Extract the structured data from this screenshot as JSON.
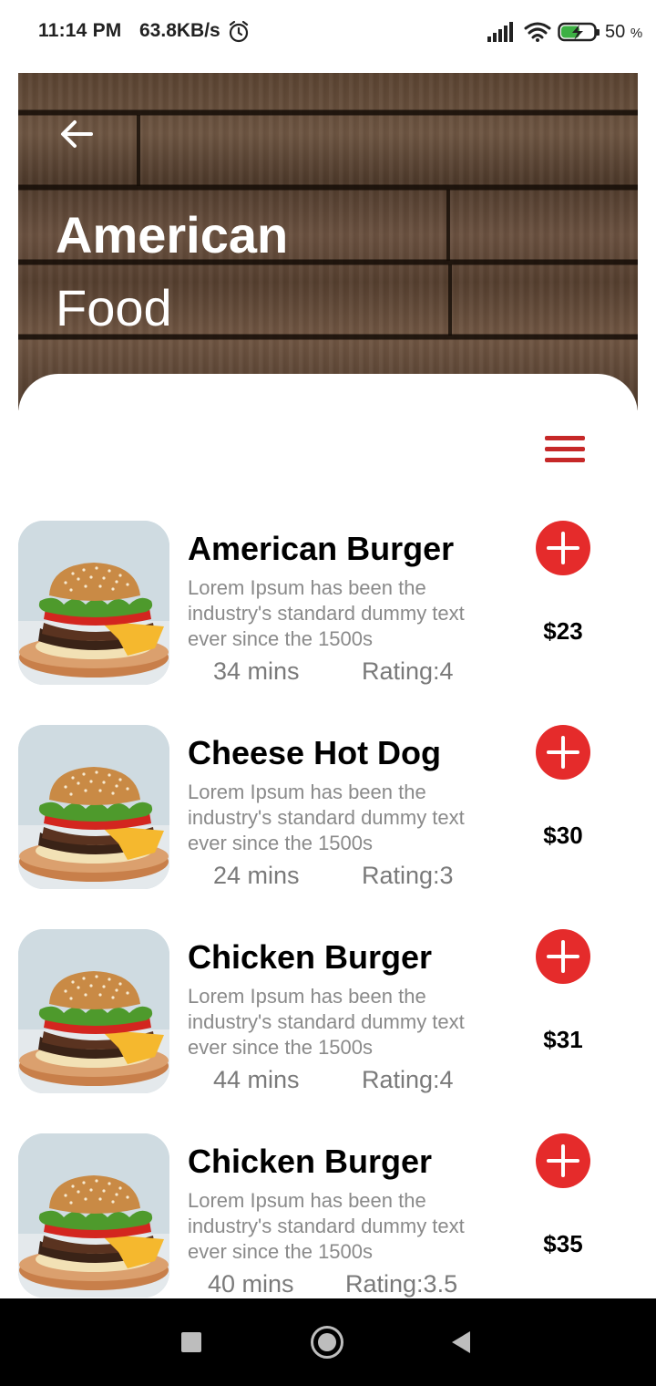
{
  "status_bar": {
    "time": "11:14 PM",
    "net_speed": "63.8KB/s",
    "battery_percent": "50",
    "battery_unit": "%",
    "icons": [
      "alarm-icon",
      "signal-icon",
      "wifi-icon",
      "battery-charging-icon"
    ]
  },
  "header": {
    "title_line1": "American",
    "title_line2": "Food",
    "back_icon": "arrow-left-icon"
  },
  "colors": {
    "accent": "#e52b2b",
    "menu": "#c62828",
    "muted_text": "#8a8a8a"
  },
  "menu_icon": "hamburger-menu-icon",
  "items": [
    {
      "name": "American Burger",
      "description": "Lorem Ipsum has been the industry's standard dummy text ever since the 1500s",
      "time": "34 mins",
      "rating": "Rating:4",
      "price": "$23"
    },
    {
      "name": "Cheese Hot Dog",
      "description": "Lorem Ipsum has been the industry's standard dummy text ever since the 1500s",
      "time": "24 mins",
      "rating": "Rating:3",
      "price": "$30"
    },
    {
      "name": "Chicken Burger",
      "description": "Lorem Ipsum has been the industry's standard dummy text ever since the 1500s",
      "time": "44 mins",
      "rating": "Rating:4",
      "price": "$31"
    },
    {
      "name": "Chicken Burger",
      "description": "Lorem Ipsum has been the industry's standard dummy text ever since the 1500s",
      "time": "40 mins",
      "rating": "Rating:3.5",
      "price": "$35"
    }
  ],
  "nav_bar": {
    "icons": [
      "recents-square-icon",
      "home-circle-icon",
      "back-triangle-icon"
    ]
  }
}
